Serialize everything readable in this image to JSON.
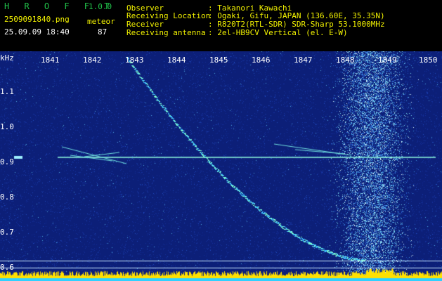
{
  "app": {
    "name": "H R O F F T",
    "version": "1.0.0"
  },
  "capture": {
    "file": "2509091840.png",
    "datetime": "25.09.09 18:40",
    "mode_label": "meteor",
    "count": "87"
  },
  "info": [
    {
      "label": "Observer",
      "value": ": Takanori Kawachi"
    },
    {
      "label": "Receiving Location",
      "value": ": Ogaki, Gifu, JAPAN (136.60E, 35.35N)"
    },
    {
      "label": "Receiver",
      "value": ": R820T2(RTL-SDR) SDR-Sharp 53.1000MHz"
    },
    {
      "label": "Receiving antenna",
      "value": ": 2el-HB9CV Vertical (el. E-W)"
    }
  ],
  "spectrogram": {
    "y_unit": "kHz",
    "time_ticks": [
      "1841",
      "1842",
      "1843",
      "1844",
      "1845",
      "1846",
      "1847",
      "1848",
      "1849",
      "1850"
    ],
    "freq_ticks": [
      "1.1",
      "1.0",
      "0.9",
      "0.8",
      "0.7",
      "0.6"
    ],
    "colors": {
      "background": "#102a8a",
      "trace": "#7fffd0",
      "activity": "#ffe000"
    }
  }
}
